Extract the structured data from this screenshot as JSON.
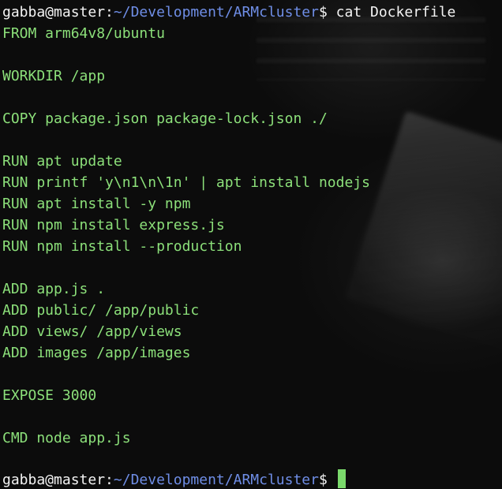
{
  "terminal": {
    "prompt_user_host": "gabba@master",
    "prompt_colon": ":",
    "prompt_path": "~/Development/ARMcluster",
    "prompt_dollar": "$",
    "command": " cat Dockerfile",
    "file_lines": [
      "FROM arm64v8/ubuntu",
      "",
      "WORKDIR /app",
      "",
      "COPY package.json package-lock.json ./",
      "",
      "RUN apt update",
      "RUN printf 'y\\n1\\n\\1n' | apt install nodejs",
      "RUN apt install -y npm",
      "RUN npm install express.js",
      "RUN npm install --production",
      "",
      "ADD app.js .",
      "ADD public/ /app/public",
      "ADD views/ /app/views",
      "ADD images /app/images",
      "",
      "EXPOSE 3000",
      "",
      "CMD node app.js"
    ],
    "colors": {
      "output_text": "#8ce07a",
      "prompt_text": "#f4f4f4",
      "path_text": "#6f8ee6",
      "cursor": "#7ad96b",
      "background": "#0c0c0c"
    }
  }
}
